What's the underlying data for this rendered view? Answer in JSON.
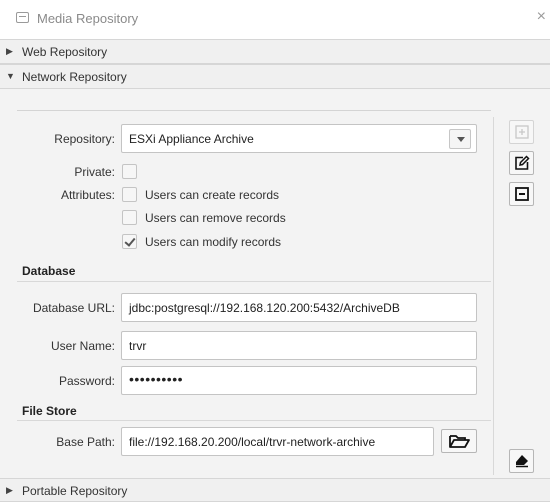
{
  "window": {
    "title": "Media Repository",
    "close_glyph": "×"
  },
  "accordion": {
    "web": {
      "label": "Web Repository",
      "arrow": "▶"
    },
    "network": {
      "label": "Network Repository",
      "arrow": "▼"
    },
    "portable": {
      "label": "Portable Repository",
      "arrow": "▶"
    }
  },
  "form": {
    "repository": {
      "label": "Repository:",
      "value": "ESXi Appliance Archive"
    },
    "private": {
      "label": "Private:",
      "checked": false
    },
    "attributes": {
      "label": "Attributes:",
      "options": [
        {
          "label": "Users can create records",
          "checked": false
        },
        {
          "label": "Users can remove records",
          "checked": false
        },
        {
          "label": "Users can modify records",
          "checked": true
        }
      ]
    },
    "database": {
      "section_title": "Database",
      "url": {
        "label": "Database URL:",
        "value": "jdbc:postgresql://192.168.120.200:5432/ArchiveDB"
      },
      "user": {
        "label": "User Name:",
        "value": "trvr"
      },
      "password": {
        "label": "Password:",
        "value": "••••••••••"
      }
    },
    "file_store": {
      "section_title": "File Store",
      "base_path": {
        "label": "Base Path:",
        "value": "file://192.168.20.200/local/trvr-network-archive"
      }
    }
  },
  "side_buttons": [
    {
      "name": "add-icon",
      "enabled": false
    },
    {
      "name": "edit-icon",
      "enabled": true
    },
    {
      "name": "remove-icon",
      "enabled": true
    },
    {
      "name": "eraser-icon",
      "enabled": true
    }
  ],
  "colors": {
    "panel_bg": "#f3f3f3",
    "header_bg": "#f0f0f0",
    "border": "#c4c4c4"
  }
}
